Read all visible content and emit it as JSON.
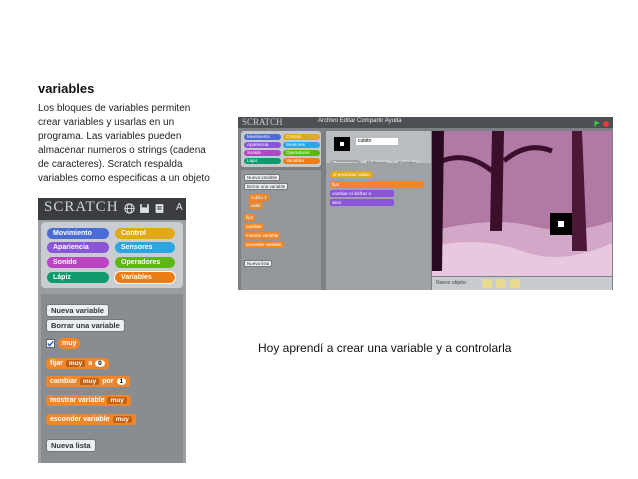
{
  "slide": {
    "title": "variables",
    "paragraph_lines": [
      "Los bloques de variables permiten",
      "crear variables y usarlas en un",
      "programa. Las variables pueden",
      "almacenar numeros o strings (cadena",
      "de  caracteres). Scratch respalda",
      "variables como especificas a un objeto"
    ],
    "caption": "Hoy aprendí a crear una variable y a controlarla"
  },
  "left_screenshot": {
    "logo": "SCRATCH",
    "partial_menu": "A",
    "categories": [
      {
        "label": "Movimiento",
        "color": "#4a6cd4"
      },
      {
        "label": "Control",
        "color": "#e1a91a"
      },
      {
        "label": "Apariencia",
        "color": "#8a55d7"
      },
      {
        "label": "Sensores",
        "color": "#2ca5e2"
      },
      {
        "label": "Sonido",
        "color": "#bb42c3"
      },
      {
        "label": "Operadores",
        "color": "#5cb712"
      },
      {
        "label": "Lápiz",
        "color": "#0e9a6c"
      },
      {
        "label": "Variables",
        "color": "#ee7d16"
      }
    ],
    "new_variable_button": "Nueva variable",
    "delete_variable_button": "Borrar una variable",
    "variable_reporter": "muy",
    "blocks": {
      "set": {
        "label": "fijar",
        "var": "muy",
        "to": "a",
        "value": "0"
      },
      "change": {
        "label": "cambiar",
        "var": "muy",
        "by": "por",
        "value": "1"
      },
      "show": {
        "label": "mostrar variable",
        "var": "muy"
      },
      "hide": {
        "label": "esconder variable",
        "var": "muy"
      }
    },
    "new_list_button": "Nueva lista"
  },
  "right_screenshot": {
    "logo": "SCRATCH",
    "menu": "Archivo  Editar  Compartir  Ayuda",
    "categories": [
      "Movimiento",
      "Control",
      "Apariencia",
      "Sensores",
      "Sonido",
      "Operadores",
      "Lápiz",
      "Variables"
    ],
    "sprite_name": "cubito",
    "tabs": [
      "Programas",
      "Disfraces",
      "Sonidos"
    ],
    "palette_buttons": [
      "Nueva variable",
      "Borrar una variable"
    ],
    "palette_vars": [
      "cubito 1",
      "valor"
    ],
    "palette_blocks": [
      "fijar",
      "cambiar",
      "mostrar variable",
      "esconder variable"
    ],
    "new_list_button": "Nueva lista",
    "script_blocks": [
      "al presionar cubito",
      "fijar",
      "cambiar el disfraz a",
      "decir"
    ],
    "sprites_label": "Nuevo objeto:"
  }
}
